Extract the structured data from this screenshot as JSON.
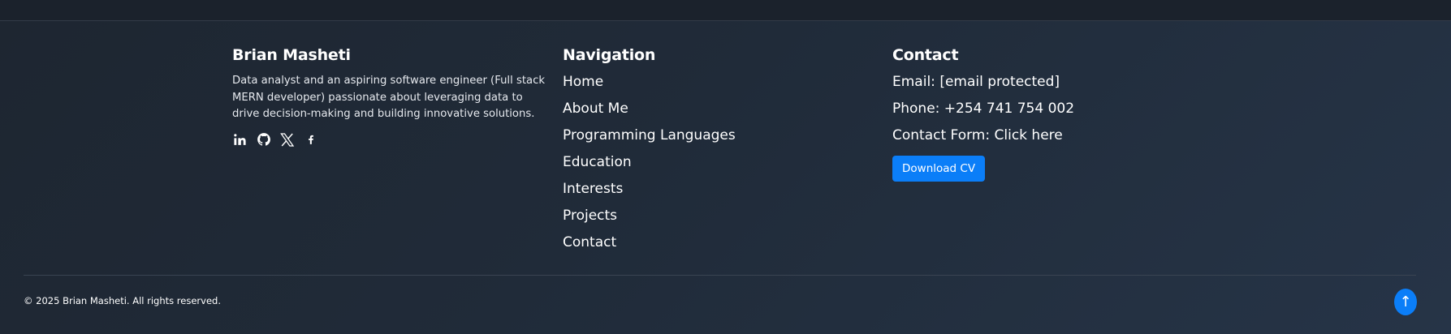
{
  "about": {
    "name": "Brian Masheti",
    "description": "Data analyst and an aspiring software engineer (Full stack MERN developer) passionate about leveraging data to drive decision-making and building innovative solutions.",
    "social": [
      "linkedin-icon",
      "github-icon",
      "x-icon",
      "facebook-icon"
    ]
  },
  "navigation": {
    "title": "Navigation",
    "items": [
      "Home",
      "About Me",
      "Programming Languages",
      "Education",
      "Interests",
      "Projects",
      "Contact"
    ]
  },
  "contact": {
    "title": "Contact",
    "email_label": "Email:",
    "email_value": "[email protected]",
    "phone_label": "Phone:",
    "phone_value": "+254 741 754 002",
    "form_label": "Contact Form:",
    "form_link": "Click here",
    "cv_button": "Download CV"
  },
  "bottom": {
    "copyright": "© 2025 Brian Masheti. All rights reserved.",
    "back_to_top_icon": "↑"
  },
  "colors": {
    "accent": "#0b7ef8",
    "background": "#1f2733"
  }
}
